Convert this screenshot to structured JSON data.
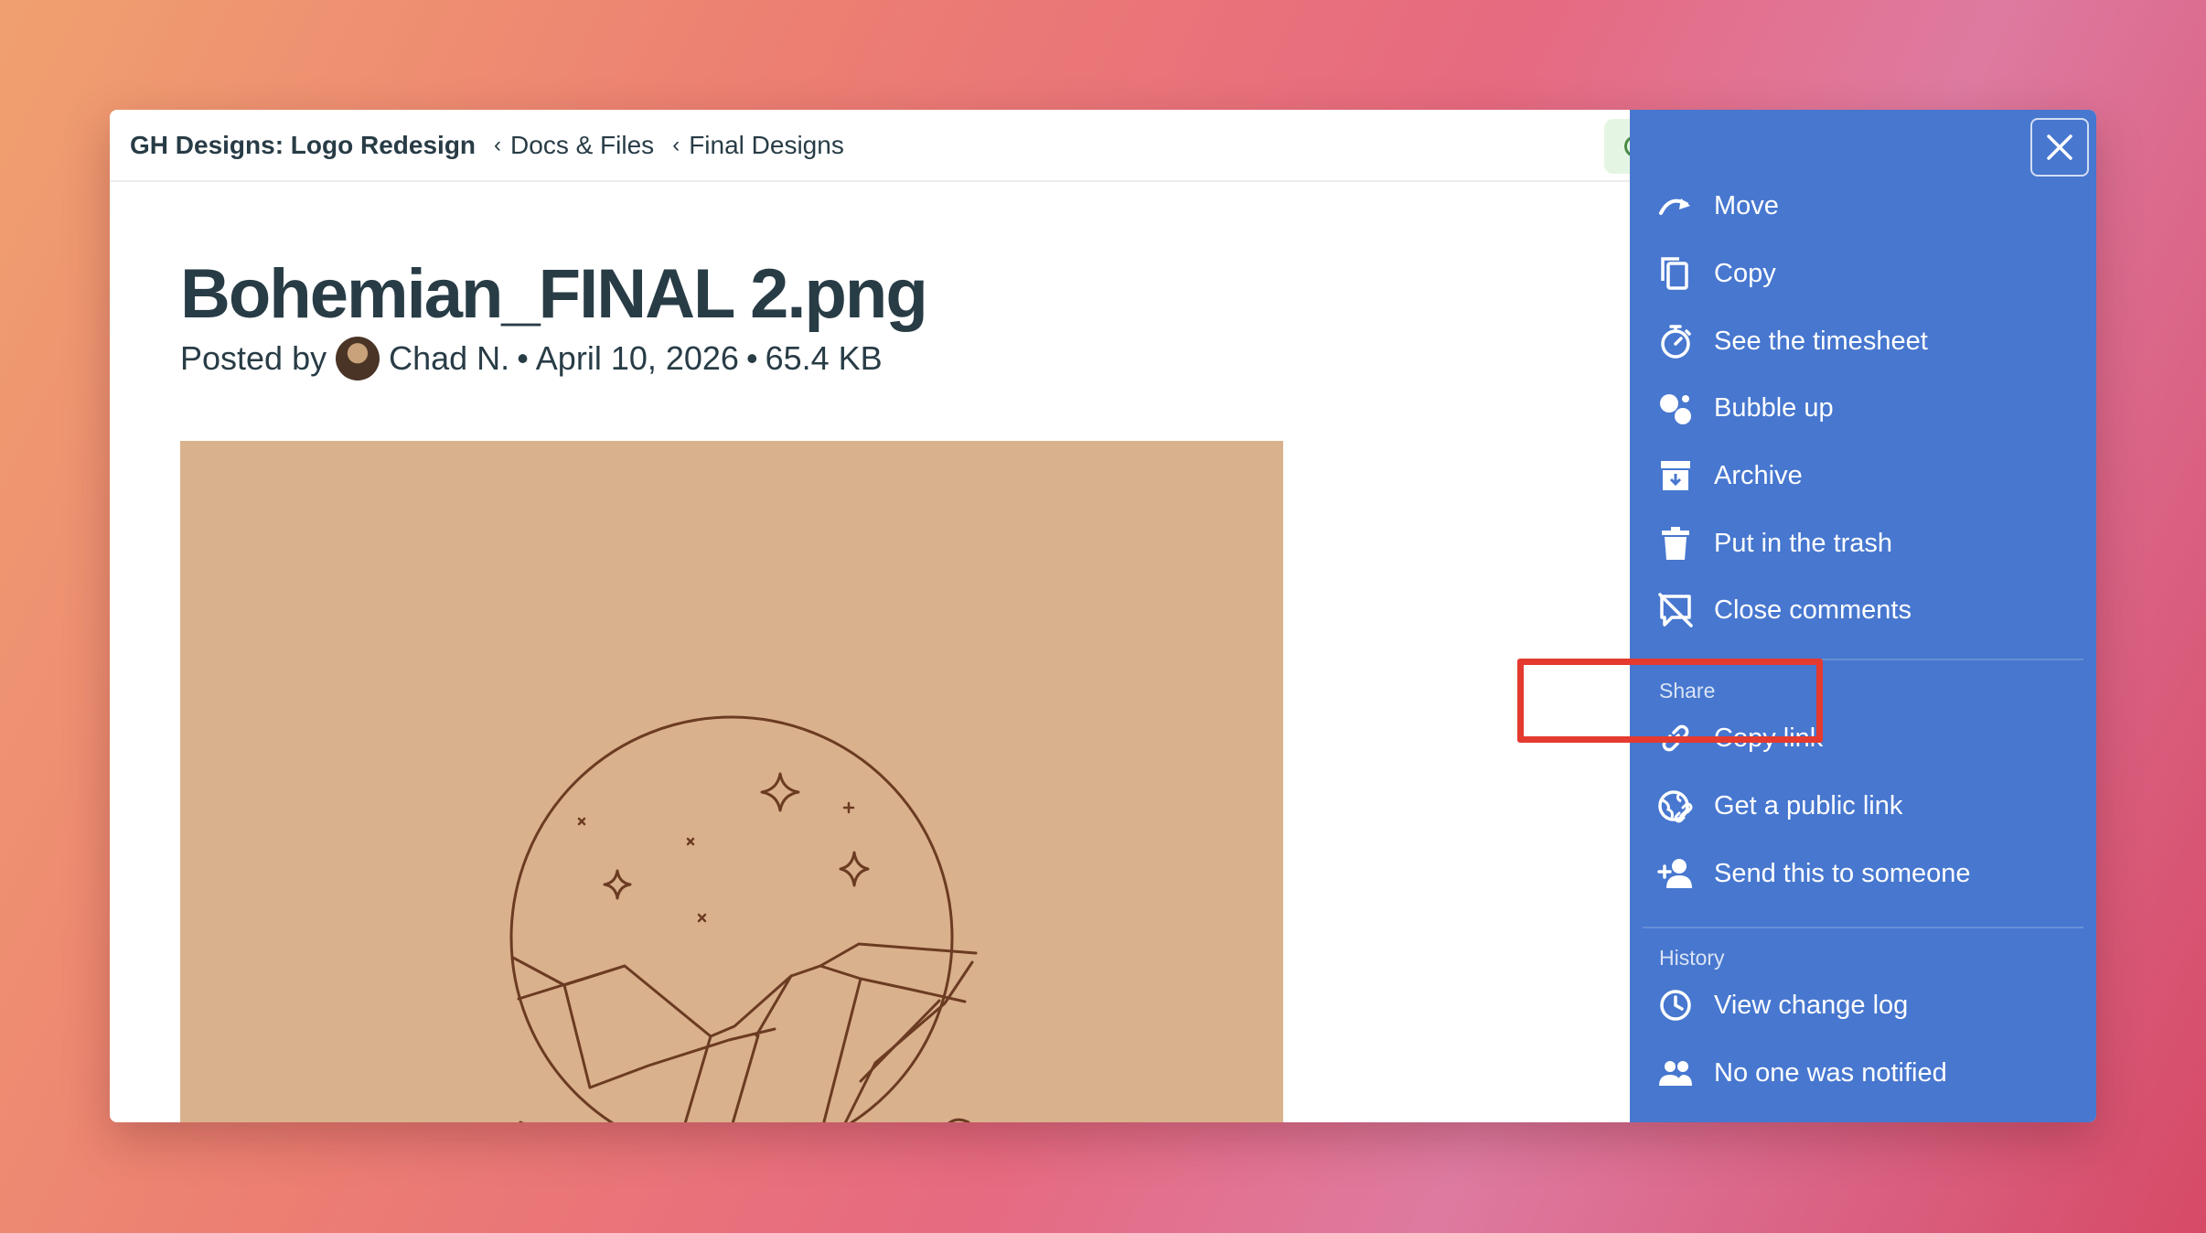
{
  "breadcrumb": {
    "project": "GH Designs: Logo Redesign",
    "sep": "‹",
    "section": "Docs & Files",
    "folder": "Final Designs"
  },
  "file": {
    "title": "Bohemian_FINAL 2.png",
    "posted_by_label": "Posted by",
    "author": "Chad N.",
    "bullet": "•",
    "date": "April 10, 2026",
    "size": "65.4 KB"
  },
  "panel": {
    "items": [
      {
        "label": "Move",
        "icon": "move-arrow-icon"
      },
      {
        "label": "Copy",
        "icon": "copy-icon"
      },
      {
        "label": "See the timesheet",
        "icon": "stopwatch-icon"
      },
      {
        "label": "Bubble up",
        "icon": "bubble-icon"
      },
      {
        "label": "Archive",
        "icon": "archive-box-icon"
      },
      {
        "label": "Put in the trash",
        "icon": "trash-icon"
      },
      {
        "label": "Close comments",
        "icon": "comment-off-icon"
      }
    ],
    "share_label": "Share",
    "share_items": [
      {
        "label": "Copy link",
        "icon": "link-icon"
      },
      {
        "label": "Get a public link",
        "icon": "globe-link-icon"
      },
      {
        "label": "Send this to someone",
        "icon": "add-person-icon"
      }
    ],
    "history_label": "History",
    "history_items": [
      {
        "label": "View change log",
        "icon": "clock-icon"
      },
      {
        "label": "No one was notified",
        "icon": "people-icon"
      }
    ]
  },
  "colors": {
    "panel_bg": "#4777cf",
    "highlight": "#e43a2f",
    "preview_bg": "#dab18d",
    "line_art": "#6b3b22"
  }
}
